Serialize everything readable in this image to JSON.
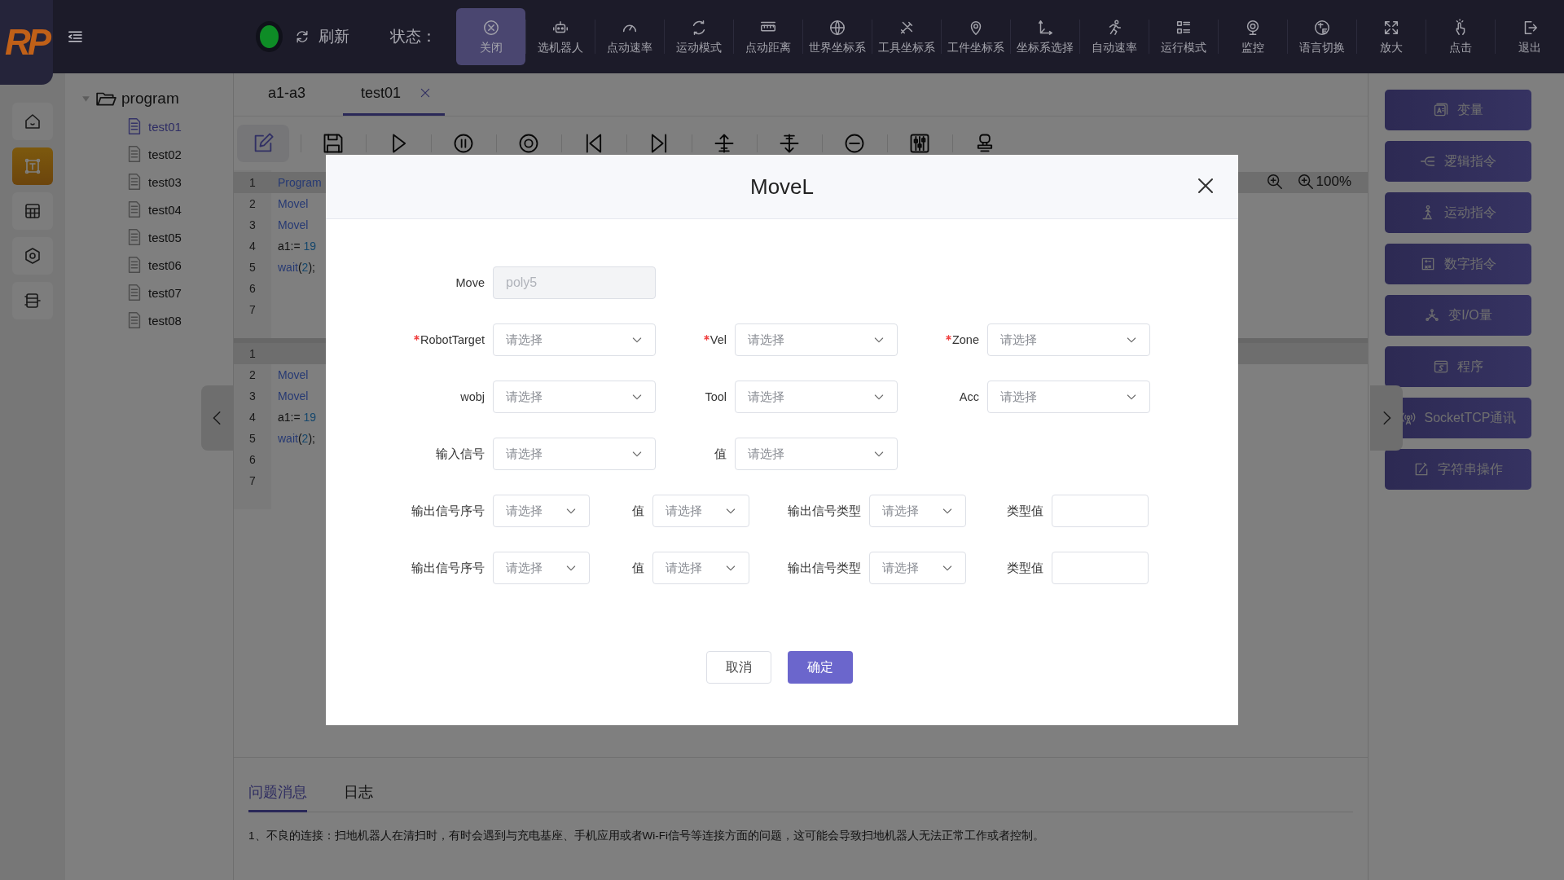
{
  "topbar": {
    "logo": "RP",
    "connected": true,
    "refresh": "刷新",
    "status_label": "状态：",
    "tools": [
      {
        "label": "关闭",
        "selected": true
      },
      {
        "label": "选机器人",
        "selected": false
      },
      {
        "label": "点动速率",
        "selected": false
      },
      {
        "label": "运动模式",
        "selected": false
      },
      {
        "label": "点动距离",
        "selected": false
      },
      {
        "label": "世界坐标系",
        "selected": false
      },
      {
        "label": "工具坐标系",
        "selected": false
      },
      {
        "label": "工件坐标系",
        "selected": false
      },
      {
        "label": "坐标系选择",
        "selected": false
      },
      {
        "label": "自动速率",
        "selected": false
      },
      {
        "label": "运行模式",
        "selected": false
      },
      {
        "label": "监控",
        "selected": false
      },
      {
        "label": "语言切换",
        "selected": false
      },
      {
        "label": "放大",
        "selected": false
      },
      {
        "label": "点击",
        "selected": false
      },
      {
        "label": "退出",
        "selected": false
      }
    ]
  },
  "rail": [
    {
      "selected": false
    },
    {
      "selected": true
    },
    {
      "selected": false
    },
    {
      "selected": false
    },
    {
      "selected": false
    }
  ],
  "tree": {
    "label": "program",
    "expanded": true,
    "children": [
      {
        "label": "test01",
        "selected": true
      },
      {
        "label": "test02",
        "selected": false
      },
      {
        "label": "test03",
        "selected": false
      },
      {
        "label": "test04",
        "selected": false
      },
      {
        "label": "test05",
        "selected": false
      },
      {
        "label": "test06",
        "selected": false
      },
      {
        "label": "test07",
        "selected": false
      },
      {
        "label": "test08",
        "selected": false
      }
    ]
  },
  "tabs": [
    {
      "label": "a1-a3",
      "selected": false,
      "closable": false
    },
    {
      "label": "test01",
      "selected": true,
      "closable": true
    }
  ],
  "zoom": {
    "reading": "100%"
  },
  "code_panels": [
    {
      "lines": [
        {
          "number": "1",
          "current": true,
          "tokens": [
            {
              "text": "Program",
              "kind": "keyword"
            }
          ]
        },
        {
          "number": "2",
          "current": false,
          "tokens": [
            {
              "text": "Movel",
              "kind": "keyword"
            }
          ]
        },
        {
          "number": "3",
          "current": false,
          "tokens": [
            {
              "text": "Movel",
              "kind": "keyword"
            }
          ]
        },
        {
          "number": "4",
          "current": false,
          "tokens": [
            {
              "text": "a1:= ",
              "kind": "plain"
            },
            {
              "text": "19",
              "kind": "number"
            }
          ]
        },
        {
          "number": "5",
          "current": false,
          "tokens": [
            {
              "text": "wait",
              "kind": "keyword"
            },
            {
              "text": "(",
              "kind": "plain"
            },
            {
              "text": "2",
              "kind": "number"
            },
            {
              "text": ");",
              "kind": "plain"
            }
          ]
        },
        {
          "number": "6",
          "current": false
        },
        {
          "number": "7",
          "current": false
        }
      ]
    },
    {
      "lines": [
        {
          "number": "1",
          "current": true
        },
        {
          "number": "2",
          "current": false,
          "tokens": [
            {
              "text": "Movel",
              "kind": "keyword"
            }
          ]
        },
        {
          "number": "3",
          "current": false,
          "tokens": [
            {
              "text": "Movel",
              "kind": "keyword"
            }
          ]
        },
        {
          "number": "4",
          "current": false,
          "tokens": [
            {
              "text": "a1:= ",
              "kind": "plain"
            },
            {
              "text": "19",
              "kind": "number"
            }
          ]
        },
        {
          "number": "5",
          "current": false,
          "tokens": [
            {
              "text": "wait",
              "kind": "keyword"
            },
            {
              "text": "(",
              "kind": "plain"
            },
            {
              "text": "2",
              "kind": "number"
            },
            {
              "text": ");",
              "kind": "plain"
            }
          ]
        },
        {
          "number": "6",
          "current": false
        },
        {
          "number": "7",
          "current": false
        }
      ]
    }
  ],
  "messages": {
    "tabs": [
      {
        "label": "问题消息",
        "selected": true
      },
      {
        "label": "日志",
        "selected": false
      }
    ],
    "text": "1、不良的连接：扫地机器人在清扫时，有时会遇到与充电基座、手机应用或者Wi-Fi信号等连接方面的问题，这可能会导致扫地机器人无法正常工作或者控制。"
  },
  "actions": [
    {
      "label": "变量"
    },
    {
      "label": "逻辑指令"
    },
    {
      "label": "运动指令"
    },
    {
      "label": "数字指令"
    },
    {
      "label": "变I/O量"
    },
    {
      "label": "程序"
    },
    {
      "label": "SocketTCP通讯"
    },
    {
      "label": "字符串操作"
    }
  ],
  "modal": {
    "title": "MoveL",
    "rows": [
      [
        {
          "label": "Move",
          "required": false,
          "kind": "input",
          "value": "poly5",
          "disabled": true
        }
      ],
      [
        {
          "label": "RobotTarget",
          "required": true,
          "kind": "select",
          "placeholder": "请选择"
        },
        {
          "label": "Vel",
          "required": true,
          "kind": "select",
          "placeholder": "请选择"
        },
        {
          "label": "Zone",
          "required": true,
          "kind": "select",
          "placeholder": "请选择"
        }
      ],
      [
        {
          "label": "wobj",
          "required": false,
          "kind": "select",
          "placeholder": "请选择"
        },
        {
          "label": "Tool",
          "required": false,
          "kind": "select",
          "placeholder": "请选择"
        },
        {
          "label": "Acc",
          "required": false,
          "kind": "select",
          "placeholder": "请选择"
        }
      ],
      [
        {
          "label": "输入信号",
          "required": false,
          "kind": "select",
          "placeholder": "请选择"
        },
        {
          "label": "值",
          "required": false,
          "kind": "select",
          "placeholder": "请选择"
        }
      ],
      [
        {
          "label": "输出信号序号",
          "required": false,
          "kind": "select",
          "placeholder": "请选择"
        },
        {
          "label": "值",
          "required": false,
          "kind": "select",
          "placeholder": "请选择"
        },
        {
          "label": "输出信号类型",
          "required": false,
          "kind": "select",
          "placeholder": "请选择"
        },
        {
          "label": "类型值",
          "required": false,
          "kind": "input",
          "disabled": false
        }
      ],
      [
        {
          "label": "输出信号序号",
          "required": false,
          "kind": "select",
          "placeholder": "请选择"
        },
        {
          "label": "值",
          "required": false,
          "kind": "select",
          "placeholder": "请选择"
        },
        {
          "label": "输出信号类型",
          "required": false,
          "kind": "select",
          "placeholder": "请选择"
        },
        {
          "label": "类型值",
          "required": false,
          "kind": "input",
          "disabled": false
        }
      ]
    ],
    "buttons": [
      {
        "label": "取消",
        "kind": "default"
      },
      {
        "label": "确定",
        "kind": "primary"
      }
    ]
  }
}
